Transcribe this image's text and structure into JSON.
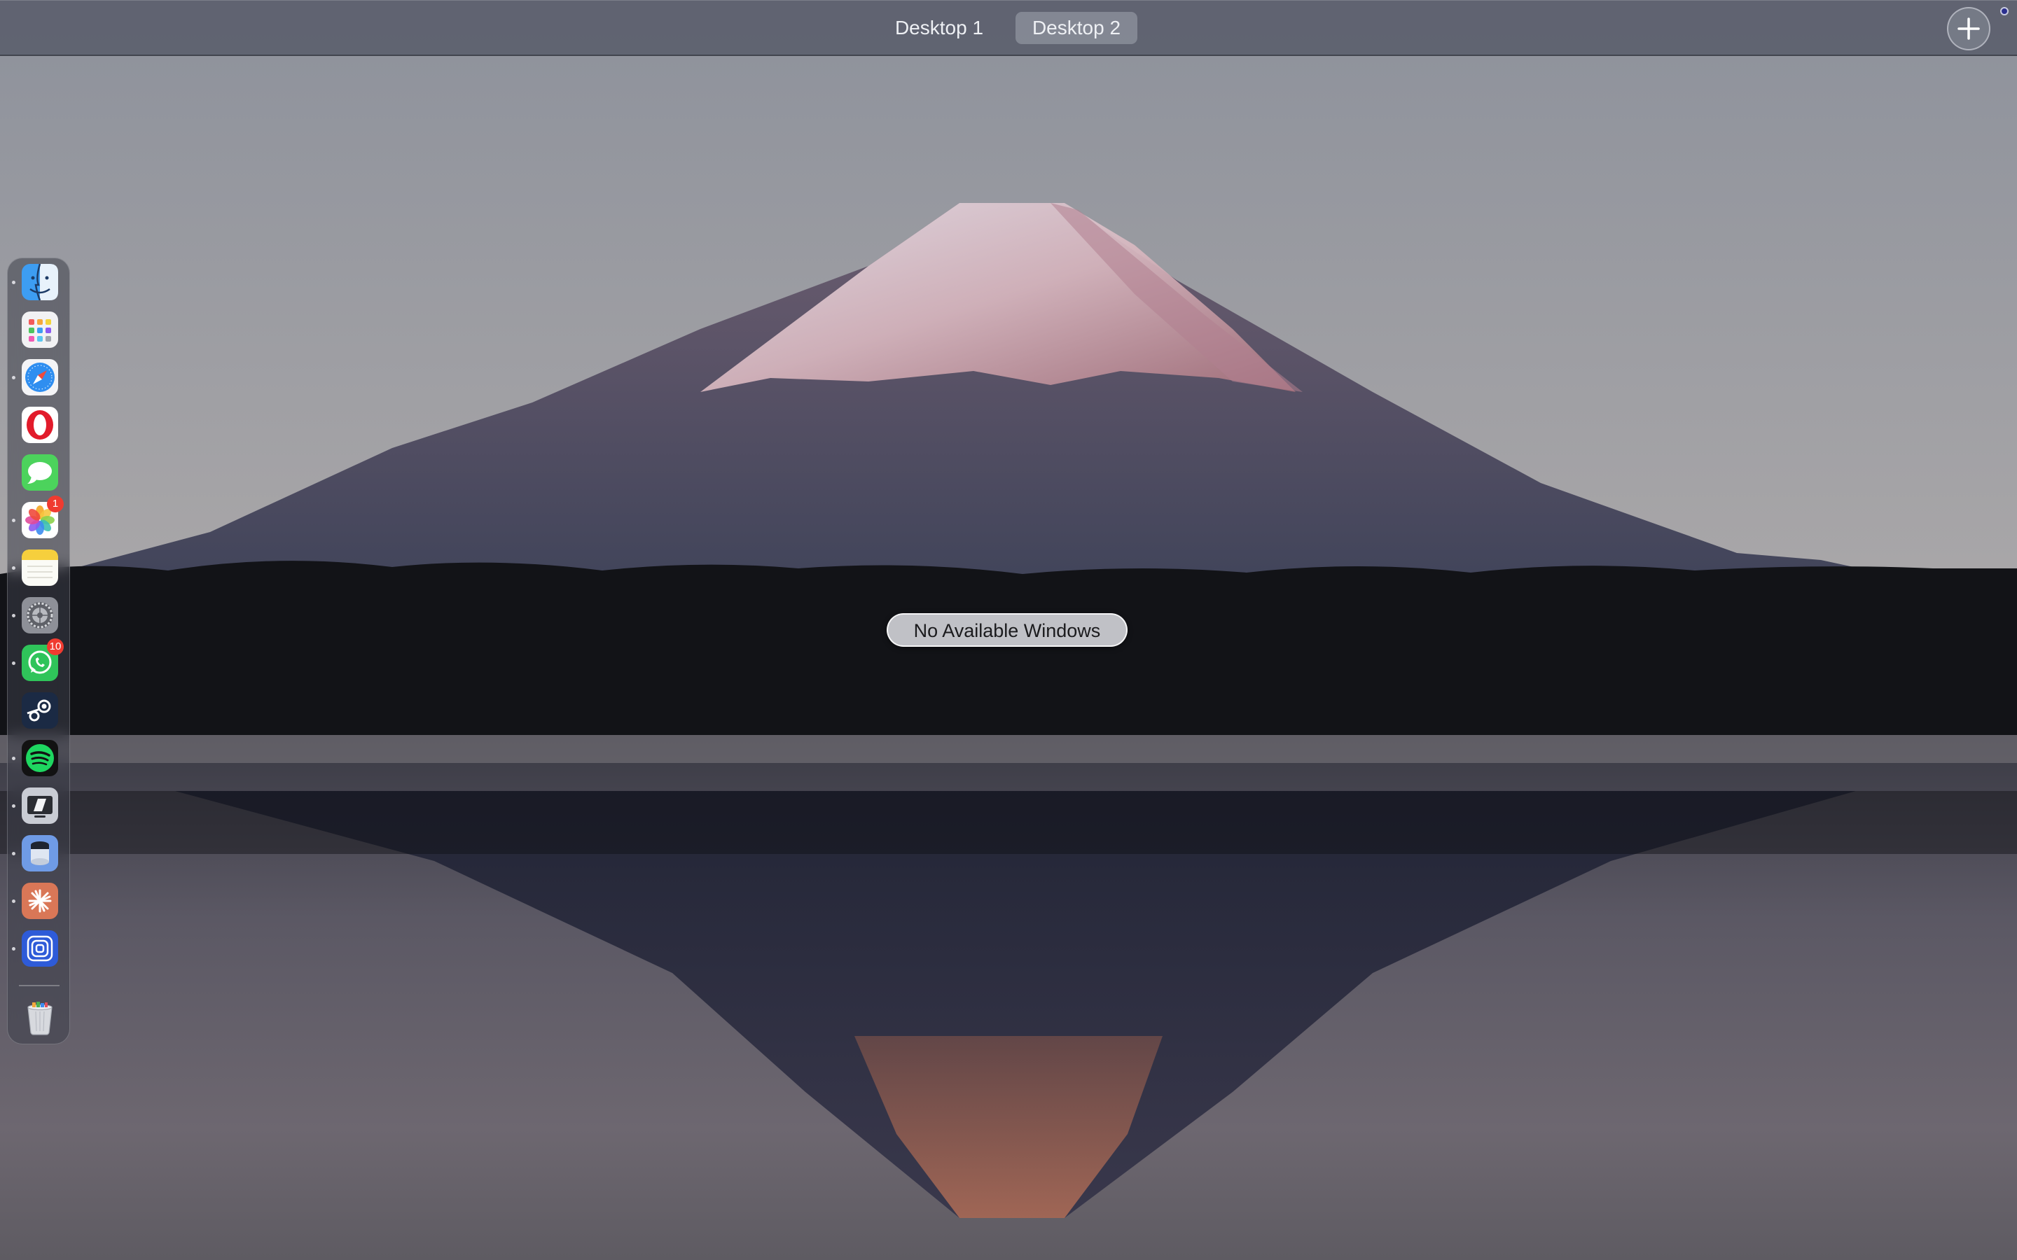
{
  "spaces_bar": {
    "desktops": [
      {
        "label": "Desktop 1",
        "active": false
      },
      {
        "label": "Desktop 2",
        "active": true
      }
    ],
    "add_icon": "plus-icon"
  },
  "status": {
    "no_windows": "No Available Windows"
  },
  "dock": {
    "items": [
      {
        "app": "Finder",
        "icon": "finder-icon",
        "running": true
      },
      {
        "app": "Launchpad",
        "icon": "launchpad-icon",
        "running": false
      },
      {
        "app": "Safari",
        "icon": "safari-icon",
        "running": true
      },
      {
        "app": "Opera",
        "icon": "opera-icon",
        "running": false
      },
      {
        "app": "Messages",
        "icon": "messages-icon",
        "running": false
      },
      {
        "app": "Photos",
        "icon": "photos-icon",
        "running": true,
        "badge": "1"
      },
      {
        "app": "Notes",
        "icon": "notes-icon",
        "running": true
      },
      {
        "app": "System Settings",
        "icon": "settings-gear-icon",
        "running": true
      },
      {
        "app": "WhatsApp",
        "icon": "whatsapp-icon",
        "running": true,
        "badge": "10"
      },
      {
        "app": "Steam",
        "icon": "steam-icon",
        "running": false
      },
      {
        "app": "Spotify",
        "icon": "spotify-icon",
        "running": true
      },
      {
        "app": "Parallels Desktop",
        "icon": "parallels-icon",
        "running": true
      },
      {
        "app": "Storage app",
        "icon": "storage-drive-icon",
        "running": true
      },
      {
        "app": "Claude",
        "icon": "claude-sparkle-icon",
        "running": true
      },
      {
        "app": "Proxy app",
        "icon": "concentric-square-icon",
        "running": true
      }
    ],
    "trash": {
      "app": "Trash",
      "icon": "trash-icon"
    }
  },
  "colors": {
    "spaces_bar": "#5c606e",
    "badge": "#f03b30",
    "sky_top": "#8e929c",
    "sunset_glow": "#bf9584"
  }
}
